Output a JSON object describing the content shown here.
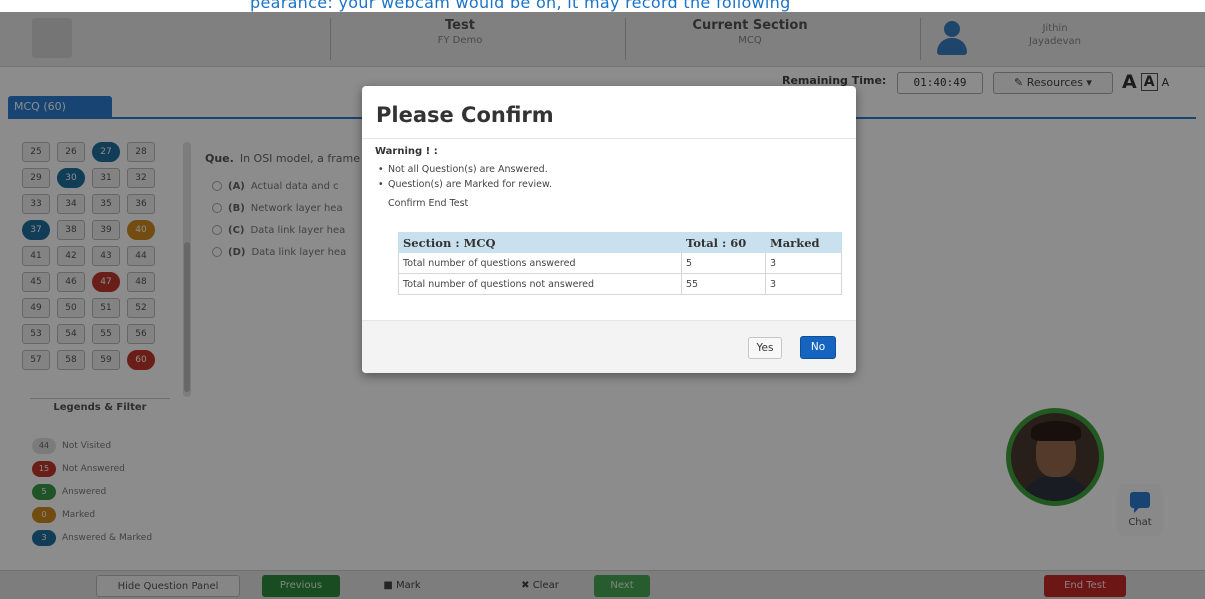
{
  "caption_text": "pearance: your webcam would be on, it may record the following",
  "header": {
    "test_title": "Test",
    "test_sub": "FY Demo",
    "section_title": "Current Section",
    "section_sub": "MCQ",
    "user_name": "Jithin",
    "user_sub": "Jayadevan"
  },
  "toolbar": {
    "remaining_label": "Remaining Time:",
    "remaining_time": "01:40:49",
    "resources_label": "✎ Resources ▾",
    "font_large": "A",
    "font_medium": "A",
    "font_small": "A"
  },
  "section_tab": "MCQ (60)",
  "palette": {
    "questions": [
      {
        "n": "25",
        "s": ""
      },
      {
        "n": "26",
        "s": ""
      },
      {
        "n": "27",
        "s": "ans"
      },
      {
        "n": "28",
        "s": ""
      },
      {
        "n": "29",
        "s": ""
      },
      {
        "n": "30",
        "s": "ans"
      },
      {
        "n": "31",
        "s": ""
      },
      {
        "n": "32",
        "s": ""
      },
      {
        "n": "33",
        "s": ""
      },
      {
        "n": "34",
        "s": ""
      },
      {
        "n": "35",
        "s": ""
      },
      {
        "n": "36",
        "s": ""
      },
      {
        "n": "37",
        "s": "ans"
      },
      {
        "n": "38",
        "s": ""
      },
      {
        "n": "39",
        "s": ""
      },
      {
        "n": "40",
        "s": "mark"
      },
      {
        "n": "41",
        "s": ""
      },
      {
        "n": "42",
        "s": ""
      },
      {
        "n": "43",
        "s": ""
      },
      {
        "n": "44",
        "s": ""
      },
      {
        "n": "45",
        "s": ""
      },
      {
        "n": "46",
        "s": ""
      },
      {
        "n": "47",
        "s": "nans"
      },
      {
        "n": "48",
        "s": ""
      },
      {
        "n": "49",
        "s": ""
      },
      {
        "n": "50",
        "s": ""
      },
      {
        "n": "51",
        "s": ""
      },
      {
        "n": "52",
        "s": ""
      },
      {
        "n": "53",
        "s": ""
      },
      {
        "n": "54",
        "s": ""
      },
      {
        "n": "55",
        "s": ""
      },
      {
        "n": "56",
        "s": ""
      },
      {
        "n": "57",
        "s": ""
      },
      {
        "n": "58",
        "s": ""
      },
      {
        "n": "59",
        "s": ""
      },
      {
        "n": "60",
        "s": "nans"
      }
    ],
    "legend_title": "Legends & Filter",
    "legends": [
      {
        "sym": "44",
        "label": "Not Visited",
        "color": "#e0e0e0",
        "text_color": "#666"
      },
      {
        "sym": "15",
        "label": "Not Answered",
        "color": "#c0392b",
        "text_color": "#fff"
      },
      {
        "sym": "5",
        "label": "Answered",
        "color": "#3a9a45",
        "text_color": "#fff"
      },
      {
        "sym": "0",
        "label": "Marked",
        "color": "#d08a1e",
        "text_color": "#fff"
      },
      {
        "sym": "3",
        "label": "Answered & Marked",
        "color": "#1f6f9e",
        "text_color": "#fff"
      }
    ]
  },
  "question": {
    "number": "Que.",
    "text": "In OSI model, a frame",
    "options": [
      {
        "label": "(A)",
        "text": "Actual data and c"
      },
      {
        "label": "(B)",
        "text": "Network layer hea"
      },
      {
        "label": "(C)",
        "text": "Data link layer hea"
      },
      {
        "label": "(D)",
        "text": "Data link layer hea"
      }
    ]
  },
  "chat_label": "Chat",
  "footer": {
    "hide_panel": "Hide Question Panel",
    "previous": "Previous",
    "mark": "■ Mark",
    "clear": "✖ Clear",
    "save": "Next",
    "end_test": "End Test"
  },
  "modal": {
    "title": "Please Confirm",
    "warning_label": "Warning ! :",
    "warnings": [
      "Not all Question(s) are Answered.",
      "Question(s) are Marked for review."
    ],
    "confirm_text": "Confirm End Test",
    "table": {
      "headers": [
        "Section : MCQ",
        "Total : 60",
        "Marked"
      ],
      "rows": [
        [
          "Total number of questions answered",
          "5",
          "3"
        ],
        [
          "Total number of questions not answered",
          "55",
          "3"
        ]
      ]
    },
    "yes_label": "Yes",
    "no_label": "No"
  }
}
